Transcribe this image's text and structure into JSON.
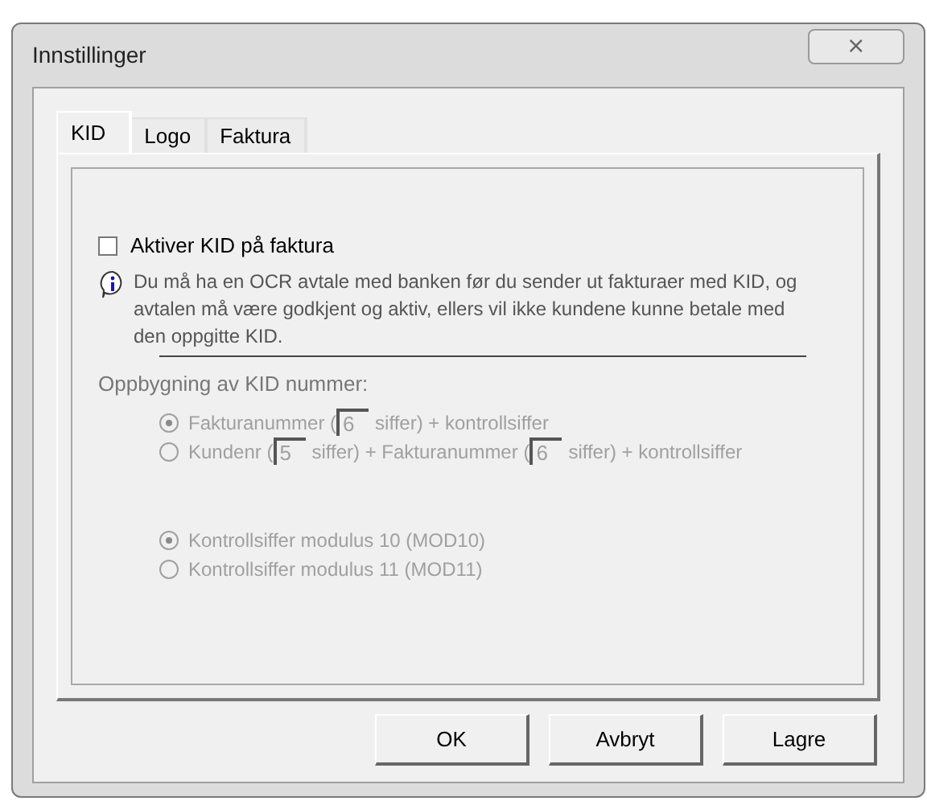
{
  "window": {
    "title": "Innstillinger",
    "close": "⨯"
  },
  "tabs": [
    {
      "label": "KID",
      "selected": true
    },
    {
      "label": "Logo",
      "selected": false
    },
    {
      "label": "Faktura",
      "selected": false
    }
  ],
  "activate": {
    "label": "Aktiver KID på faktura",
    "checked": false
  },
  "info": "Du må ha en OCR avtale med banken før du sender ut fakturaer med KID, og avtalen må være godkjent og aktiv, ellers vil ikke kundene kunne betale med den oppgitte KID.",
  "structure_label": "Oppbygning av KID nummer:",
  "structure_options": [
    {
      "selected": true,
      "disabled": true,
      "parts": [
        {
          "kind": "text",
          "text": "Fakturanummer ("
        },
        {
          "kind": "field",
          "value": "6"
        },
        {
          "kind": "text",
          "text": "siffer) + kontrollsiffer"
        }
      ]
    },
    {
      "selected": false,
      "disabled": true,
      "parts": [
        {
          "kind": "text",
          "text": "Kundenr ("
        },
        {
          "kind": "field",
          "value": "5"
        },
        {
          "kind": "text",
          "text": "siffer) + Fakturanummer ("
        },
        {
          "kind": "field",
          "value": "6"
        },
        {
          "kind": "text",
          "text": "siffer) + kontrollsiffer"
        }
      ]
    }
  ],
  "check_options": [
    {
      "label": "Kontrollsiffer modulus 10 (MOD10)",
      "selected": true,
      "disabled": true
    },
    {
      "label": "Kontrollsiffer modulus 11 (MOD11)",
      "selected": false,
      "disabled": true
    }
  ],
  "buttons": [
    "OK",
    "Avbryt",
    "Lagre"
  ]
}
